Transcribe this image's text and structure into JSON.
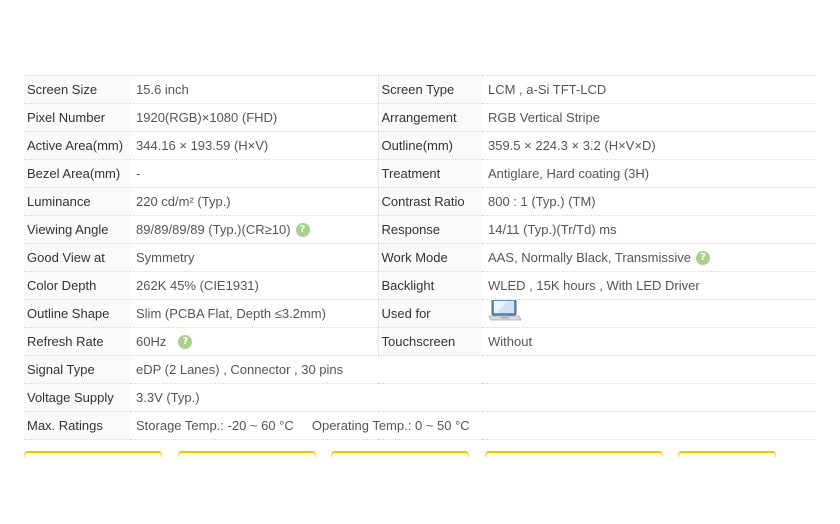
{
  "specs": {
    "screen_size": {
      "label": "Screen Size",
      "value": "15.6 inch"
    },
    "screen_type": {
      "label": "Screen Type",
      "value": "LCM ,    a-Si TFT-LCD"
    },
    "pixel_number": {
      "label": "Pixel Number",
      "value": "1920(RGB)×1080    (FHD)"
    },
    "arrangement": {
      "label": "Arrangement",
      "value": "RGB Vertical Stripe"
    },
    "active_area": {
      "label": "Active Area(mm)",
      "value": "344.16 × 193.59 (H×V)"
    },
    "outline": {
      "label": "Outline(mm)",
      "value": "359.5 × 224.3 × 3.2 (H×V×D)"
    },
    "bezel_area": {
      "label": "Bezel Area(mm)",
      "value": "-"
    },
    "treatment": {
      "label": "Treatment",
      "value": "Antiglare, Hard coating (3H)"
    },
    "luminance": {
      "label": "Luminance",
      "value": "220 cd/m² (Typ.)"
    },
    "contrast": {
      "label": "Contrast Ratio",
      "value": "800 : 1 (Typ.) (TM)"
    },
    "viewing_angle": {
      "label": "Viewing Angle",
      "value": "89/89/89/89 (Typ.)(CR≥10)"
    },
    "response": {
      "label": "Response",
      "value": "14/11 (Typ.)(Tr/Td) ms"
    },
    "good_view": {
      "label": "Good View at",
      "value": "Symmetry"
    },
    "work_mode": {
      "label": "Work Mode",
      "value": "AAS, Normally Black, Transmissive"
    },
    "color_depth": {
      "label": "Color Depth",
      "value": "262K    45% (CIE1931)"
    },
    "backlight": {
      "label": "Backlight",
      "value": "WLED , 15K hours , With LED Driver"
    },
    "outline_shape": {
      "label": "Outline Shape",
      "value": "Slim (PCBA Flat, Depth ≤3.2mm)"
    },
    "used_for": {
      "label": "Used for",
      "value": "",
      "icon": "laptop-icon"
    },
    "refresh_rate": {
      "label": "Refresh Rate",
      "value": "60Hz"
    },
    "touchscreen": {
      "label": "Touchscreen",
      "value": "Without"
    },
    "signal_type": {
      "label": "Signal Type",
      "value": "eDP (2 Lanes) , Connector , 30 pins"
    },
    "voltage": {
      "label": "Voltage Supply",
      "value": "3.3V (Typ.)"
    },
    "max_ratings": {
      "label": "Max. Ratings",
      "value": "Storage Temp.: -20 ~ 60 °C     Operating Temp.: 0 ~ 50 °C"
    }
  },
  "help_icon": {
    "glyph": "?",
    "color": "#a9cf8e"
  },
  "colors": {
    "tab_accent": "#f2c200",
    "label_bg": "#fafafa",
    "border": "#d6d6d6"
  }
}
